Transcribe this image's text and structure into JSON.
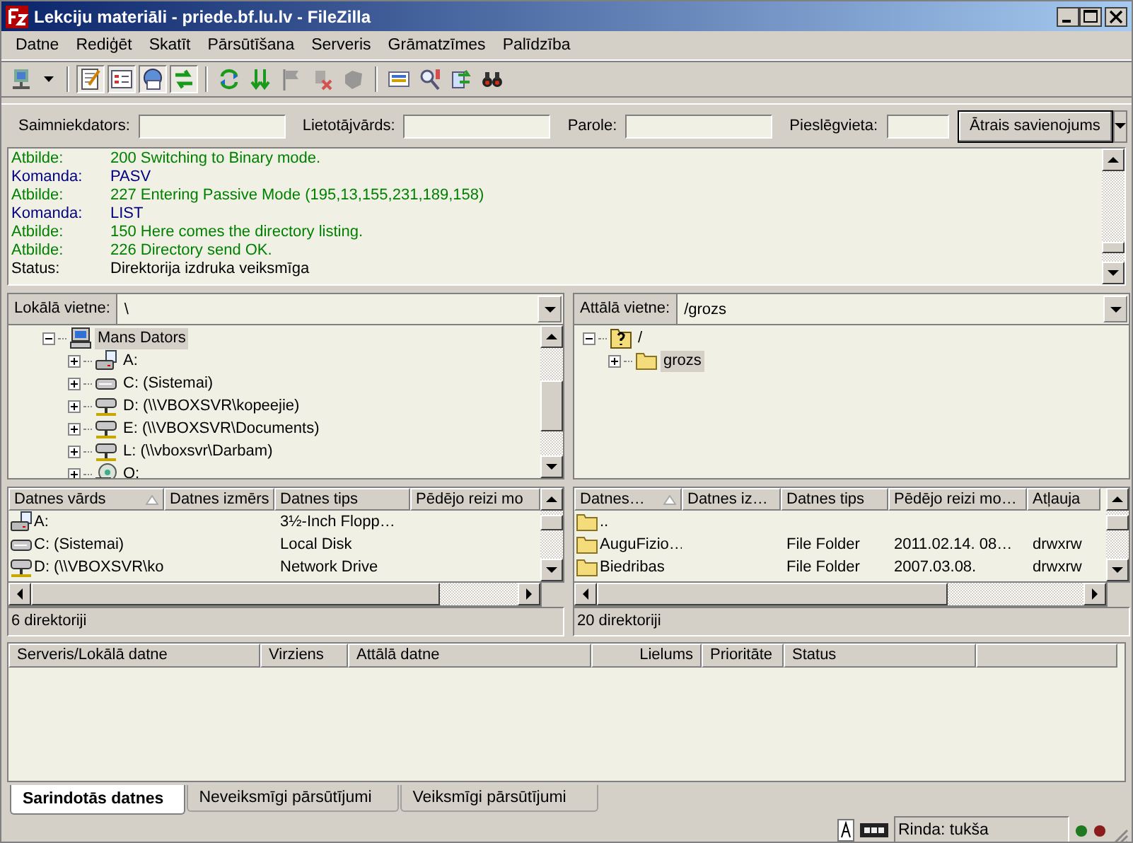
{
  "window": {
    "title": "Lekciju materiāli - priede.bf.lu.lv - FileZilla"
  },
  "menu": [
    "Datne",
    "Rediģēt",
    "Skatīt",
    "Pārsūtīšana",
    "Serveris",
    "Grāmatzīmes",
    "Palīdzība"
  ],
  "toolbar": [
    {
      "kind": "site-manager",
      "pressed": false,
      "disabled": false
    },
    {
      "kind": "log",
      "pressed": true,
      "disabled": false
    },
    {
      "kind": "local-tree",
      "pressed": true,
      "disabled": false
    },
    {
      "kind": "remote-tree",
      "pressed": true,
      "disabled": false
    },
    {
      "kind": "queue",
      "pressed": true,
      "disabled": false
    },
    {
      "kind": "refresh",
      "pressed": false,
      "disabled": false
    },
    {
      "kind": "process-queue",
      "pressed": false,
      "disabled": false
    },
    {
      "kind": "flag",
      "pressed": false,
      "disabled": true
    },
    {
      "kind": "disconnect",
      "pressed": false,
      "disabled": true
    },
    {
      "kind": "reconnect",
      "pressed": false,
      "disabled": true
    },
    {
      "kind": "filter",
      "pressed": false,
      "disabled": false
    },
    {
      "kind": "compare",
      "pressed": false,
      "disabled": false
    },
    {
      "kind": "sync",
      "pressed": false,
      "disabled": false
    },
    {
      "kind": "search",
      "pressed": false,
      "disabled": false
    }
  ],
  "quickconnect": {
    "fields": [
      {
        "label": "Saimniekdators:"
      },
      {
        "label": "Lietotājvārds:"
      },
      {
        "label": "Parole:"
      },
      {
        "label": "Pieslēgvieta:"
      }
    ],
    "button": "Ātrais savienojums"
  },
  "log": [
    {
      "kind": "response",
      "label": "Atbilde:",
      "text": "200 Switching to Binary mode."
    },
    {
      "kind": "command",
      "label": "Komanda:",
      "text": "PASV"
    },
    {
      "kind": "response",
      "label": "Atbilde:",
      "text": "227 Entering Passive Mode (195,13,155,231,189,158)"
    },
    {
      "kind": "command",
      "label": "Komanda:",
      "text": "LIST"
    },
    {
      "kind": "response",
      "label": "Atbilde:",
      "text": "150 Here comes the directory listing."
    },
    {
      "kind": "response",
      "label": "Atbilde:",
      "text": "226 Directory send OK."
    },
    {
      "kind": "status",
      "label": "Status:",
      "text": "Direktorija izdruka veiksmīga"
    }
  ],
  "local": {
    "label": "Lokālā vietne:",
    "path": "\\",
    "tree": [
      {
        "label": "Mans Dators",
        "kind": "computer",
        "expanded": true,
        "selected": true,
        "children": [
          {
            "label": "A:",
            "kind": "floppy",
            "expanded": false,
            "selected": false
          },
          {
            "label": "C: (Sistemai)",
            "kind": "disk",
            "expanded": false,
            "selected": false
          },
          {
            "label": "D: (\\\\VBOXSVR\\kopeejie)",
            "kind": "network",
            "expanded": false,
            "selected": false
          },
          {
            "label": "E: (\\\\VBOXSVR\\Documents)",
            "kind": "network",
            "expanded": false,
            "selected": false
          },
          {
            "label": "L: (\\\\vboxsvr\\Darbam)",
            "kind": "network",
            "expanded": false,
            "selected": false
          },
          {
            "label": "O:",
            "kind": "cdrom",
            "expanded": false,
            "selected": false
          }
        ]
      }
    ],
    "columns": [
      {
        "label": "Datnes vārds",
        "sorted": true
      },
      {
        "label": "Datnes izmērs",
        "sorted": false
      },
      {
        "label": "Datnes tips",
        "sorted": false
      },
      {
        "label": "Pēdējo reizi mo",
        "sorted": false
      }
    ],
    "rows": [
      {
        "kind": "floppy",
        "cells": [
          "A:",
          "",
          "3½-Inch Flopp…",
          ""
        ]
      },
      {
        "kind": "disk",
        "cells": [
          "C: (Sistemai)",
          "",
          "Local Disk",
          ""
        ]
      },
      {
        "kind": "network",
        "cells": [
          "D: (\\\\VBOXSVR\\ko",
          "",
          "Network Drive",
          ""
        ]
      }
    ],
    "status": "6 direktoriji"
  },
  "remote": {
    "label": "Attālā vietne:",
    "path": "/grozs",
    "tree": [
      {
        "label": "/",
        "kind": "unknown-folder",
        "expanded": true,
        "selected": false,
        "children": [
          {
            "label": "grozs",
            "kind": "folder",
            "expanded": false,
            "selected": true
          }
        ]
      }
    ],
    "columns": [
      {
        "label": "Datnes…",
        "sorted": true
      },
      {
        "label": "Datnes iz…",
        "sorted": false
      },
      {
        "label": "Datnes tips",
        "sorted": false
      },
      {
        "label": "Pēdējo reizi mo…",
        "sorted": false
      },
      {
        "label": "Atļauja",
        "sorted": false
      }
    ],
    "rows": [
      {
        "kind": "folder",
        "cells": [
          "..",
          "",
          "",
          "",
          ""
        ]
      },
      {
        "kind": "folder",
        "cells": [
          "AuguFizio…",
          "",
          "File Folder",
          "2011.02.14. 08…",
          "drwxrw"
        ]
      },
      {
        "kind": "folder",
        "cells": [
          "Biedribas",
          "",
          "File Folder",
          "2007.03.08.",
          "drwxrw"
        ]
      }
    ],
    "status": "20 direktoriji"
  },
  "queue": {
    "columns": [
      "Serveris/Lokālā datne",
      "Virziens",
      "Attālā datne",
      "Lielums",
      "Prioritāte",
      "Status"
    ]
  },
  "tabs": [
    {
      "label": "Sarindotās datnes",
      "selected": true
    },
    {
      "label": "Neveiksmīgi pārsūtījumi",
      "selected": false
    },
    {
      "label": "Veiksmīgi pārsūtījumi",
      "selected": false
    }
  ],
  "statusbar": {
    "queue": "Rinda: tukša",
    "lights": [
      {
        "color": "#1f7a1f"
      },
      {
        "color": "#8a1c1c"
      }
    ]
  }
}
